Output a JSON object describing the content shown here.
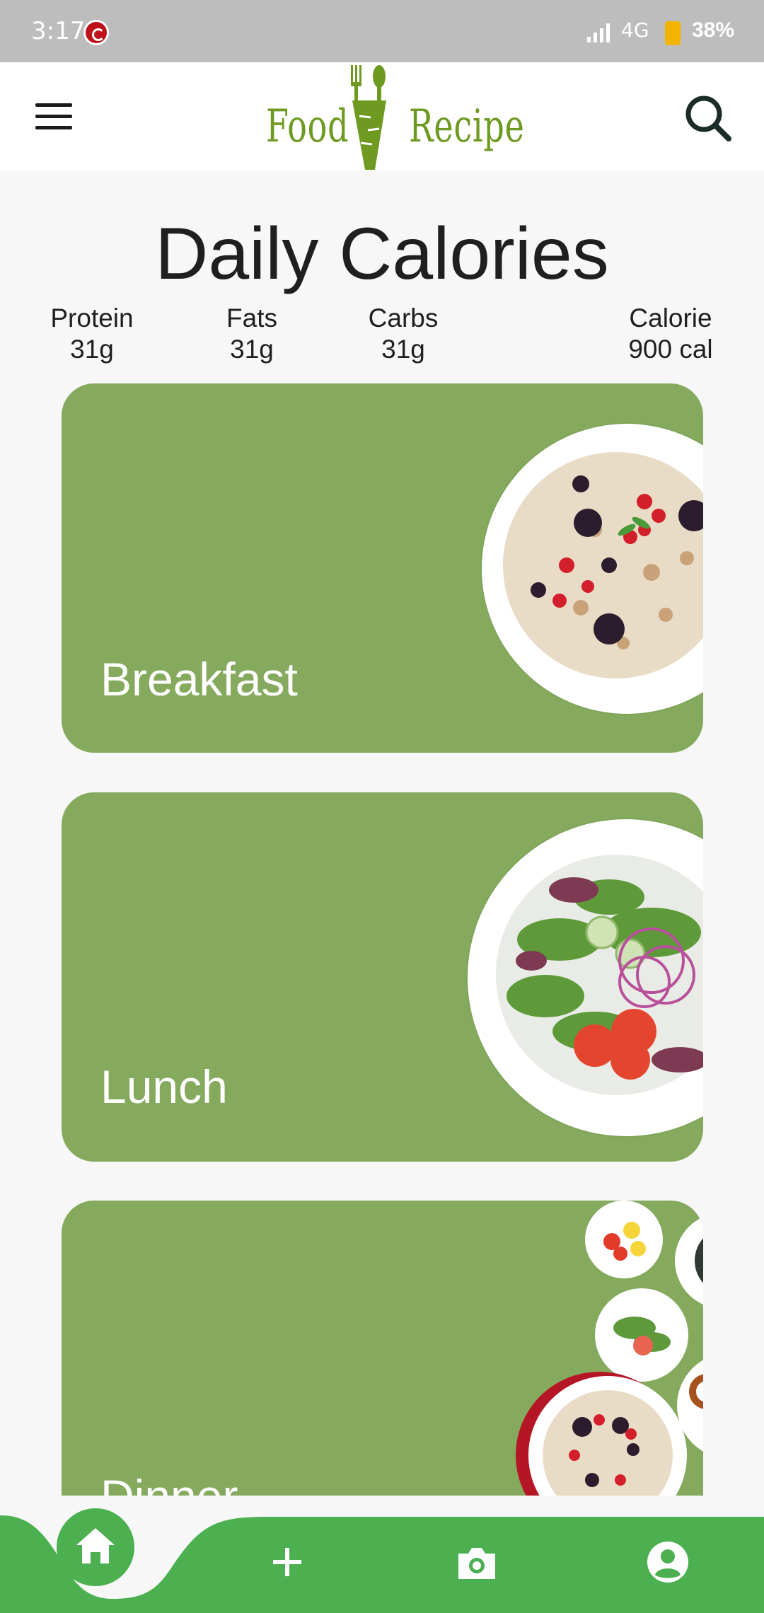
{
  "status_bar": {
    "time": "3:17",
    "network": "4G",
    "battery": "38%"
  },
  "app_bar": {
    "logo_left": "Food",
    "logo_right": "Recipe"
  },
  "daily": {
    "title": "Daily Calories",
    "macros": [
      {
        "label": "Protein",
        "value": "31g"
      },
      {
        "label": "Fats",
        "value": "31g"
      },
      {
        "label": "Carbs",
        "value": "31g"
      },
      {
        "label": "Calorie",
        "value": "900 cal"
      }
    ]
  },
  "meals": [
    {
      "label": "Breakfast"
    },
    {
      "label": "Lunch"
    },
    {
      "label": "Dinner"
    }
  ],
  "colors": {
    "card_green": "#85aa5d",
    "nav_green": "#4caf50",
    "logo_green": "#6f9a22"
  },
  "bottom_nav": {
    "items": [
      "home-icon",
      "add-icon",
      "camera-icon",
      "account-icon"
    ],
    "active": "home-icon"
  }
}
